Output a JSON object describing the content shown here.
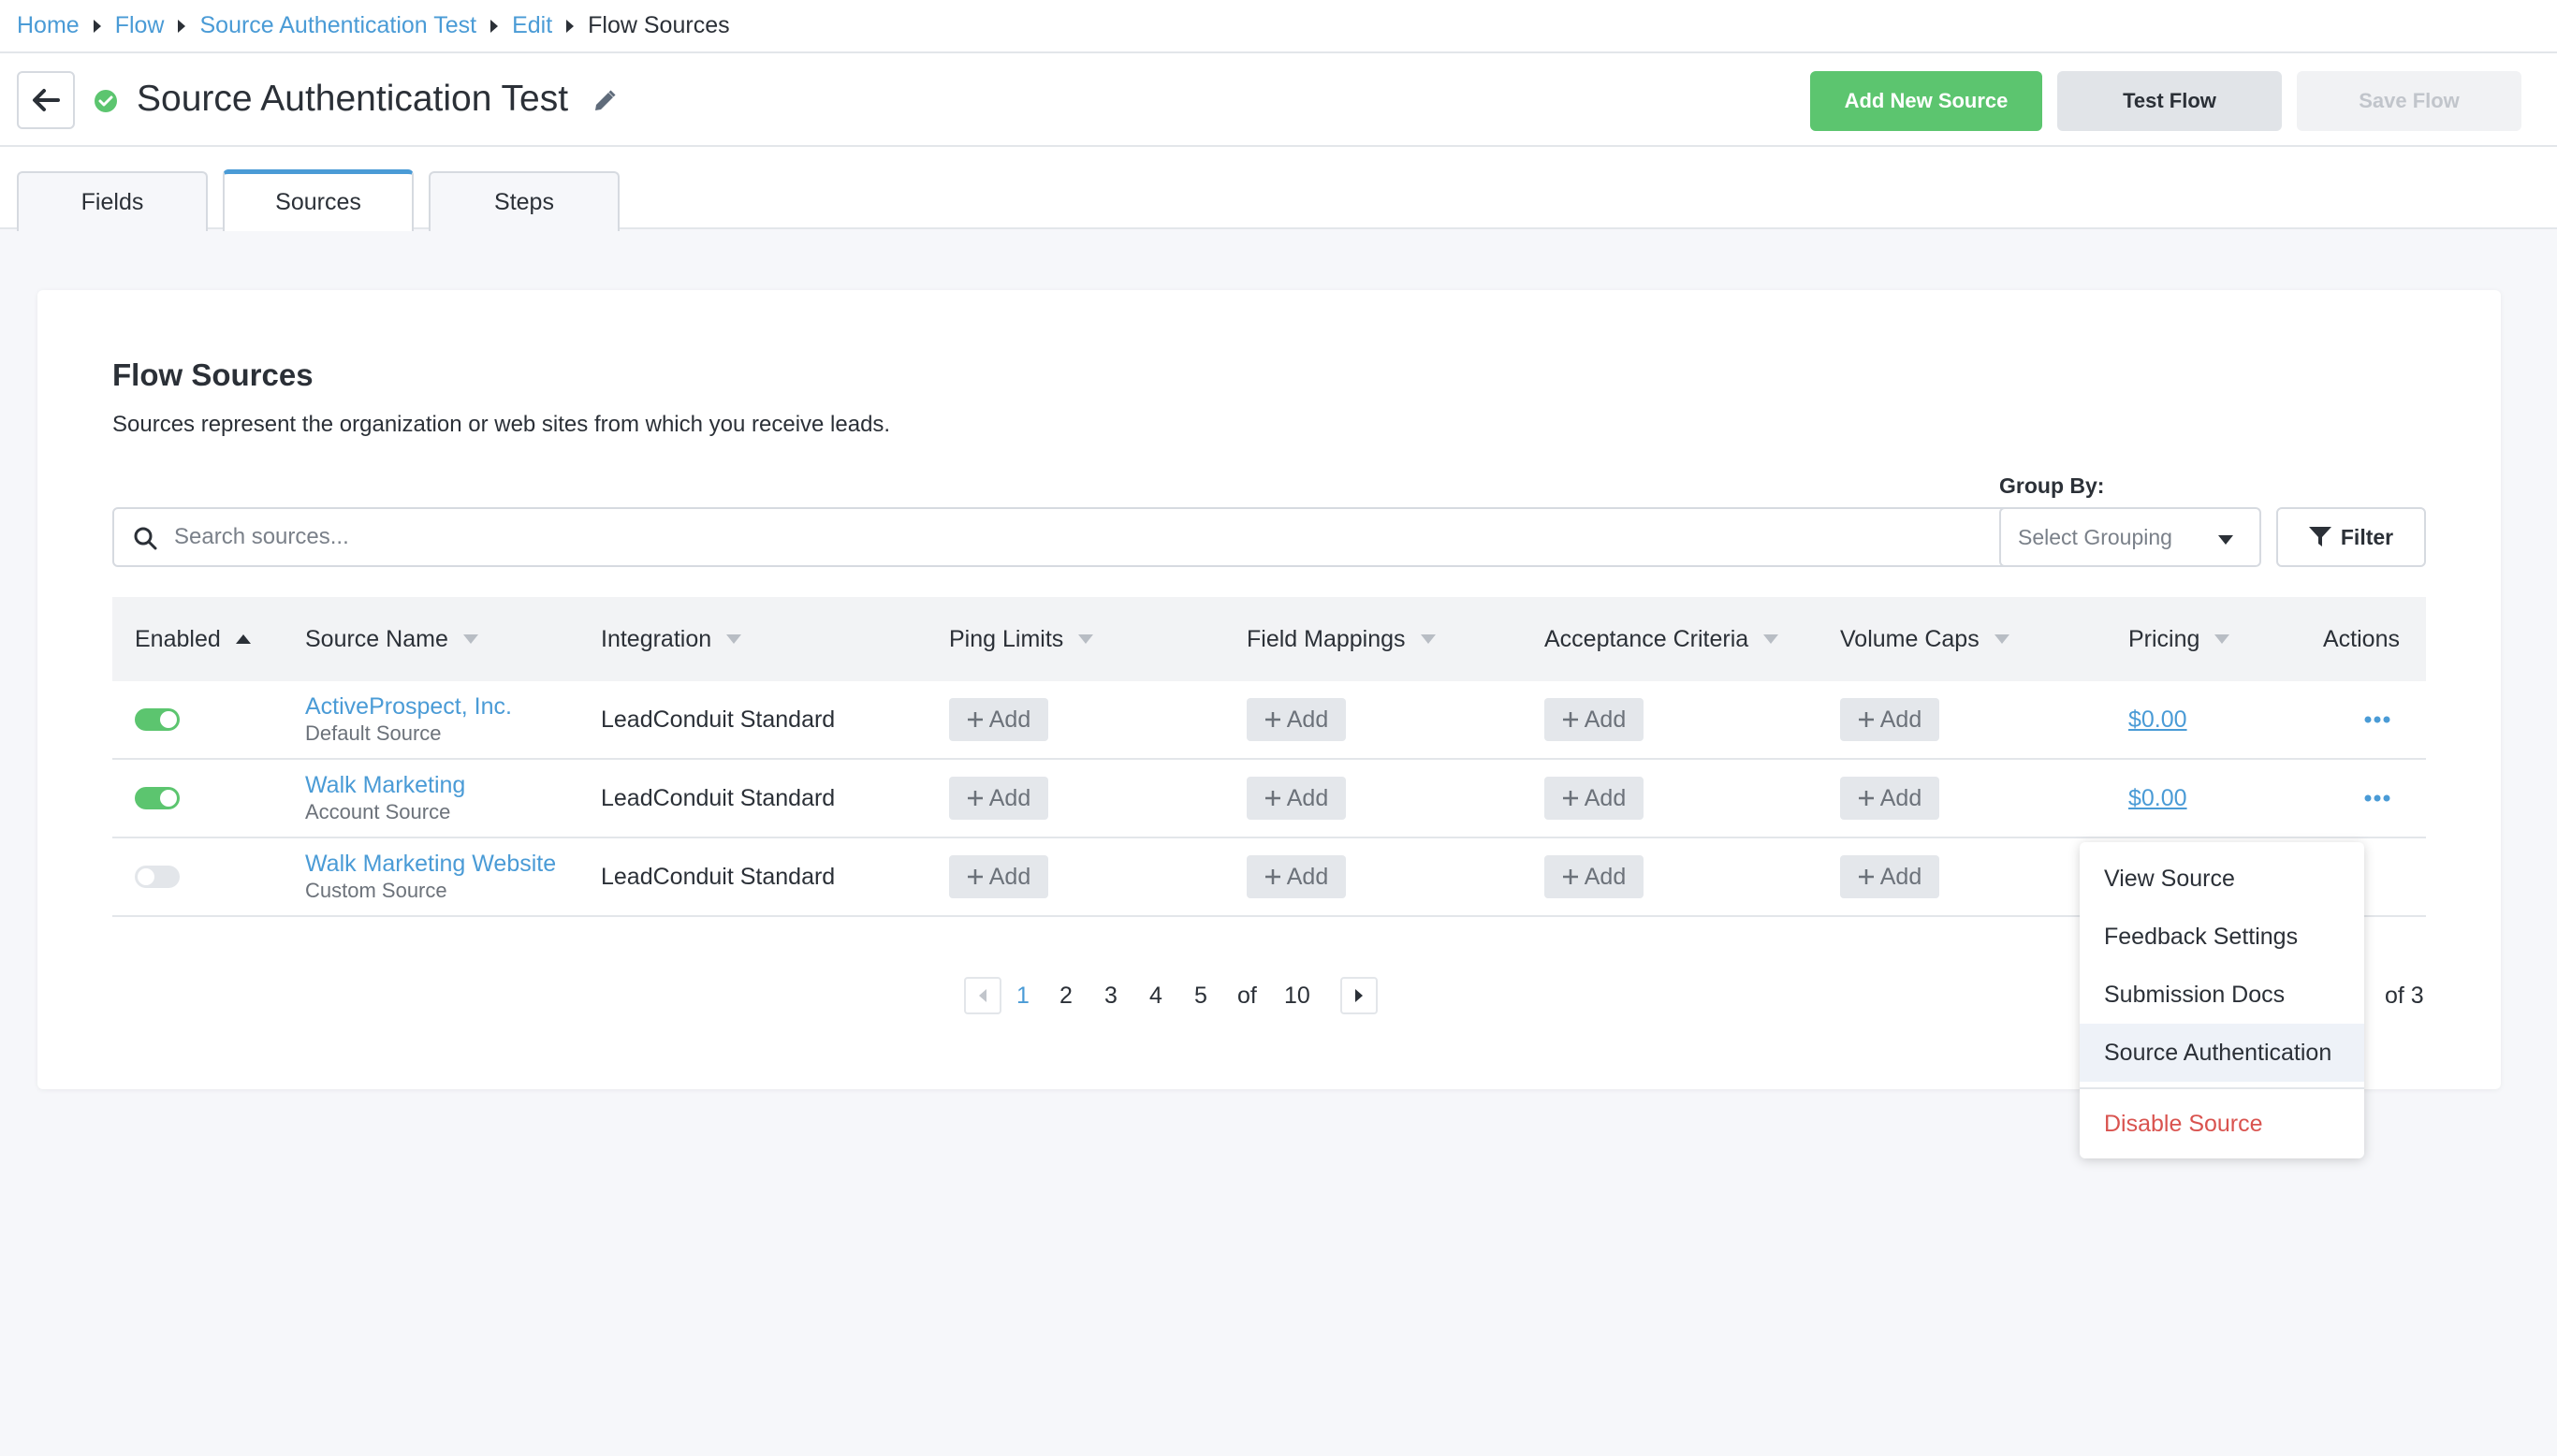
{
  "breadcrumb": {
    "items": [
      {
        "label": "Home"
      },
      {
        "label": "Flow"
      },
      {
        "label": "Source Authentication Test"
      },
      {
        "label": "Edit"
      }
    ],
    "current": "Flow Sources"
  },
  "header": {
    "title": "Source Authentication Test",
    "add_source_label": "Add New Source",
    "test_flow_label": "Test Flow",
    "save_flow_label": "Save Flow"
  },
  "tabs": [
    {
      "label": "Fields",
      "active": false
    },
    {
      "label": "Sources",
      "active": true
    },
    {
      "label": "Steps",
      "active": false
    }
  ],
  "card": {
    "title": "Flow Sources",
    "description": "Sources represent the organization or web sites from which you receive leads."
  },
  "search": {
    "placeholder": "Search sources...",
    "value": ""
  },
  "group_by": {
    "label": "Group By:",
    "selected": "Select Grouping"
  },
  "filter": {
    "label": "Filter"
  },
  "table": {
    "columns": {
      "enabled": "Enabled",
      "source_name": "Source Name",
      "integration": "Integration",
      "ping_limits": "Ping Limits",
      "field_mappings": "Field Mappings",
      "acceptance_criteria": "Acceptance Criteria",
      "volume_caps": "Volume Caps",
      "pricing": "Pricing",
      "actions": "Actions"
    },
    "add_label": "Add",
    "rows": [
      {
        "enabled": true,
        "name": "ActiveProspect, Inc.",
        "type": "Default Source",
        "integration": "LeadConduit Standard",
        "pricing": "$0.00"
      },
      {
        "enabled": true,
        "name": "Walk Marketing",
        "type": "Account Source",
        "integration": "LeadConduit Standard",
        "pricing": "$0.00"
      },
      {
        "enabled": false,
        "name": "Walk Marketing Website",
        "type": "Custom Source",
        "integration": "LeadConduit Standard",
        "pricing": ""
      }
    ]
  },
  "pagination": {
    "pages": [
      "1",
      "2",
      "3",
      "4",
      "5"
    ],
    "active": "1",
    "of_label": "of",
    "total": "10",
    "right_label": "of 3"
  },
  "actions_menu": {
    "items": [
      "View Source",
      "Feedback Settings",
      "Submission Docs",
      "Source Authentication"
    ],
    "highlighted": "Source Authentication",
    "danger": "Disable Source"
  },
  "colors": {
    "accent": "#4a9bd6",
    "success": "#5cc56f",
    "danger": "#d9534f"
  }
}
